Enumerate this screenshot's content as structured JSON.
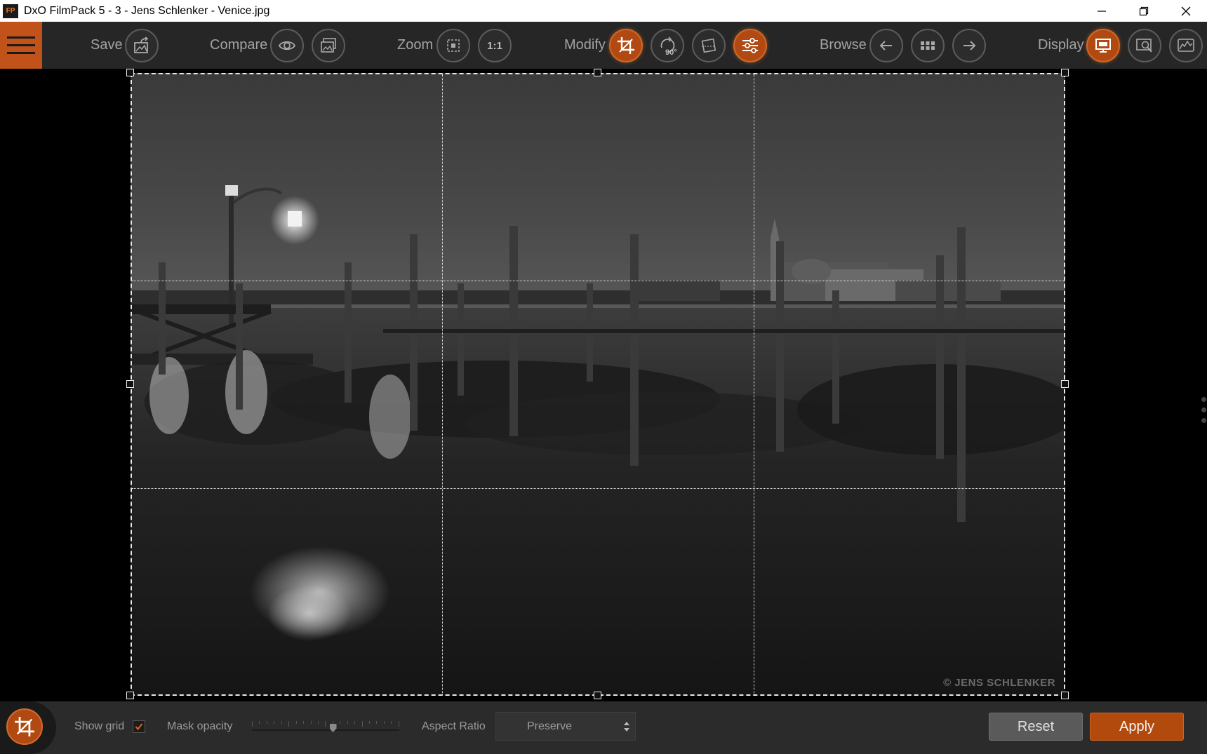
{
  "window": {
    "logo_text": "FP",
    "title": "DxO FilmPack 5 - 3 - Jens Schlenker - Venice.jpg"
  },
  "toolbar": {
    "save_label": "Save",
    "compare_label": "Compare",
    "zoom_label": "Zoom",
    "zoom_one_to_one": "1:1",
    "modify_label": "Modify",
    "rotate_label": "90°",
    "browse_label": "Browse",
    "display_label": "Display"
  },
  "image": {
    "watermark": "© JENS SCHLENKER"
  },
  "crop_panel": {
    "show_grid_label": "Show grid",
    "show_grid_checked": true,
    "mask_opacity_label": "Mask opacity",
    "mask_opacity_value": 0.55,
    "aspect_ratio_label": "Aspect Ratio",
    "aspect_ratio_value": "Preserve",
    "reset_label": "Reset",
    "apply_label": "Apply"
  },
  "colors": {
    "accent": "#c1531a",
    "toolbar_bg": "#262626",
    "bottom_bg": "#2b2b2b"
  },
  "icons": [
    "menu-icon",
    "save-icon",
    "eye-icon",
    "compare-images-icon",
    "zoom-fit-icon",
    "crop-icon",
    "rotate-icon",
    "straighten-icon",
    "sliders-icon",
    "arrow-left-icon",
    "grid-view-icon",
    "arrow-right-icon",
    "monitor-icon",
    "loupe-icon",
    "histogram-icon",
    "checkmark-icon"
  ]
}
